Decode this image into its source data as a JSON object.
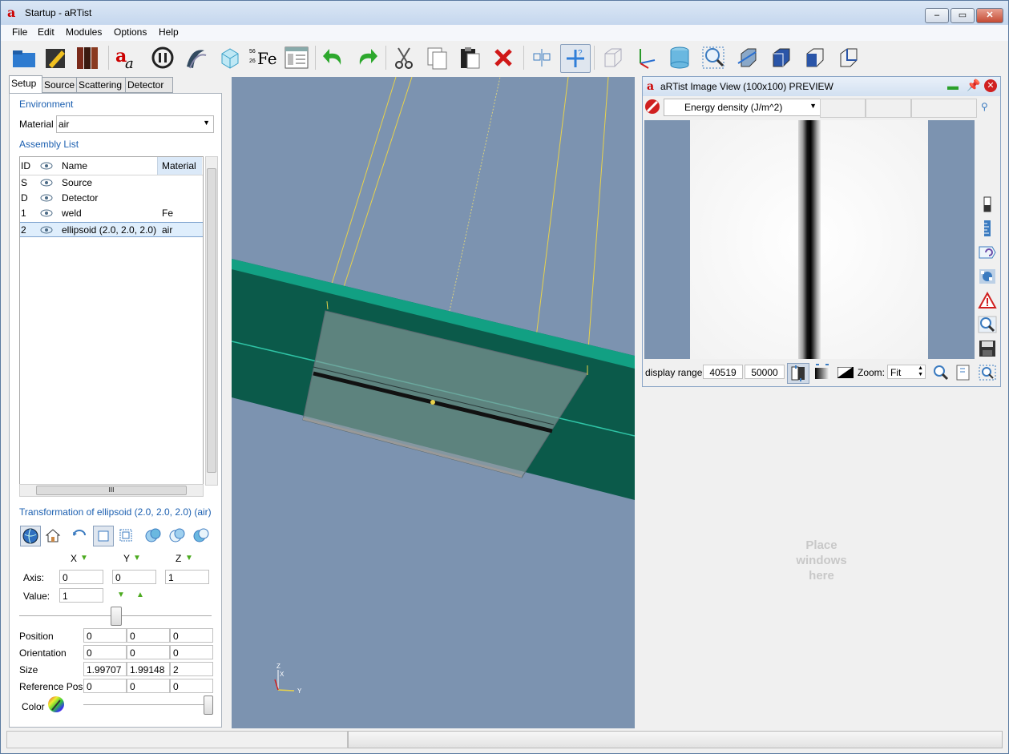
{
  "window": {
    "title": "Startup - aRTist",
    "app_icon": "a"
  },
  "menu": [
    "File",
    "Edit",
    "Modules",
    "Options",
    "Help"
  ],
  "toolbar": {
    "icons": [
      "open-folder-icon",
      "edit-pencil-icon",
      "library-books-icon",
      "text-aa-icon",
      "scan-icon",
      "spiral-icon",
      "cube-wire-icon",
      "fe-element-icon",
      "list-view-icon",
      "undo-icon",
      "redo-icon",
      "cut-icon",
      "copy-icon",
      "paste-icon",
      "delete-icon",
      "align-icon",
      "move-help-icon",
      "box-view-icon",
      "axes-icon",
      "cylinder-icon",
      "zoom-fit-icon",
      "view-front-icon",
      "view-side-icon",
      "view-top-icon",
      "view-iso-icon"
    ],
    "fe_label_mass": "56",
    "fe_label_num": "26",
    "fe_label_sym": "Fe"
  },
  "tabs": [
    "Setup",
    "Source",
    "Scattering",
    "Detector"
  ],
  "environment": {
    "title": "Environment",
    "material_label": "Material",
    "material_value": "air"
  },
  "assembly": {
    "title": "Assembly List",
    "headers": {
      "id": "ID",
      "name": "Name",
      "material": "Material"
    },
    "rows": [
      {
        "id": "S",
        "name": "Source",
        "material": ""
      },
      {
        "id": "D",
        "name": "Detector",
        "material": ""
      },
      {
        "id": "1",
        "name": "weld",
        "material": "Fe"
      },
      {
        "id": "2",
        "name": "ellipsoid (2.0, 2.0, 2.0)",
        "material": "air"
      }
    ],
    "scroll_glyph": "III"
  },
  "transform": {
    "title": "Transformation of ellipsoid (2.0, 2.0, 2.0) (air)",
    "x": "X",
    "y": "Y",
    "z": "Z",
    "axis_label": "Axis:",
    "axis": [
      "0",
      "0",
      "1"
    ],
    "value_label": "Value:",
    "value": "1",
    "position_label": "Position",
    "position": [
      "0",
      "0",
      "0"
    ],
    "orientation_label": "Orientation",
    "orientation": [
      "0",
      "0",
      "0"
    ],
    "size_label": "Size",
    "size": [
      "1.99707",
      "1.99148",
      "2"
    ],
    "refpos_label": "Reference Pos.",
    "refpos": [
      "0",
      "0",
      "0"
    ],
    "color_label": "Color"
  },
  "imageview": {
    "title": "aRTist Image View (100x100) PREVIEW",
    "quantity": "Energy density (J/m^2)",
    "range_label": "display range",
    "range_min": "40519",
    "range_max": "50000",
    "zoom_label": "Zoom:",
    "zoom_value": "Fit"
  },
  "placeholder": {
    "line1": "Place",
    "line2": "windows",
    "line3": "here"
  },
  "axes": {
    "z": "Z",
    "x": "X",
    "y": "Y"
  },
  "colors": {
    "accent": "#1b5fb0",
    "plate": "#0b5a4a",
    "plate_top": "#12a083",
    "background": "#7c93b0"
  }
}
